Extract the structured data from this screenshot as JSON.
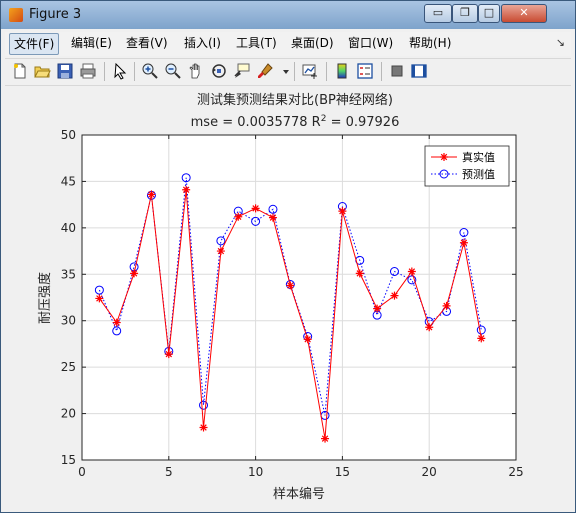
{
  "window": {
    "title": "Figure 3"
  },
  "menu": [
    {
      "label": "文件(F)"
    },
    {
      "label": "编辑(E)"
    },
    {
      "label": "查看(V)"
    },
    {
      "label": "插入(I)"
    },
    {
      "label": "工具(T)"
    },
    {
      "label": "桌面(D)"
    },
    {
      "label": "窗口(W)"
    },
    {
      "label": "帮助(H)"
    }
  ],
  "toolbar_icons": [
    "new-figure-icon",
    "open-file-icon",
    "save-icon",
    "print-icon",
    "edit-plot-arrow-icon",
    "zoom-in-icon",
    "zoom-out-icon",
    "pan-hand-icon",
    "rotate-3d-icon",
    "data-cursor-icon",
    "brush-icon",
    "brush-dropdown-icon",
    "link-plot-icon",
    "insert-colorbar-icon",
    "insert-legend-icon",
    "hide-plot-tools-icon",
    "show-plot-tools-icon"
  ],
  "colors": {
    "true_series": "#ff0000",
    "pred_series": "#0000ff",
    "grid": "#dcdcdc",
    "axes_bg": "#ffffff"
  },
  "chart_data": {
    "type": "line",
    "title_line1": "测试集预测结果对比(BP神经网络)",
    "title_line2_prefix": "mse = 0.0035778 R",
    "title_line2_sup": "2",
    "title_line2_suffix": " = 0.97926",
    "xlabel": "样本编号",
    "ylabel": "耐压强度",
    "xlim": [
      0,
      25
    ],
    "ylim": [
      15,
      50
    ],
    "xticks": [
      0,
      5,
      10,
      15,
      20,
      25
    ],
    "yticks": [
      15,
      20,
      25,
      30,
      35,
      40,
      45,
      50
    ],
    "grid": true,
    "legend_position": "top-right",
    "x": [
      1,
      2,
      3,
      4,
      5,
      6,
      7,
      8,
      9,
      10,
      11,
      12,
      13,
      14,
      15,
      16,
      17,
      18,
      19,
      20,
      21,
      22,
      23
    ],
    "series": [
      {
        "name": "真实值",
        "marker": "star",
        "linestyle": "solid",
        "values": [
          32.4,
          29.8,
          35.1,
          43.6,
          26.4,
          44.1,
          18.5,
          37.5,
          41.2,
          42.1,
          41.1,
          33.8,
          28.0,
          17.3,
          41.8,
          35.1,
          31.3,
          32.7,
          35.3,
          29.3,
          31.6,
          38.4,
          28.1
        ]
      },
      {
        "name": "预测值",
        "marker": "circle",
        "linestyle": "dotted",
        "values": [
          33.3,
          28.9,
          35.8,
          43.5,
          26.7,
          45.4,
          20.9,
          38.6,
          41.8,
          40.7,
          42.0,
          33.9,
          28.3,
          19.8,
          42.3,
          36.5,
          30.6,
          35.3,
          34.4,
          29.9,
          31.0,
          39.5,
          29.0
        ]
      }
    ]
  }
}
